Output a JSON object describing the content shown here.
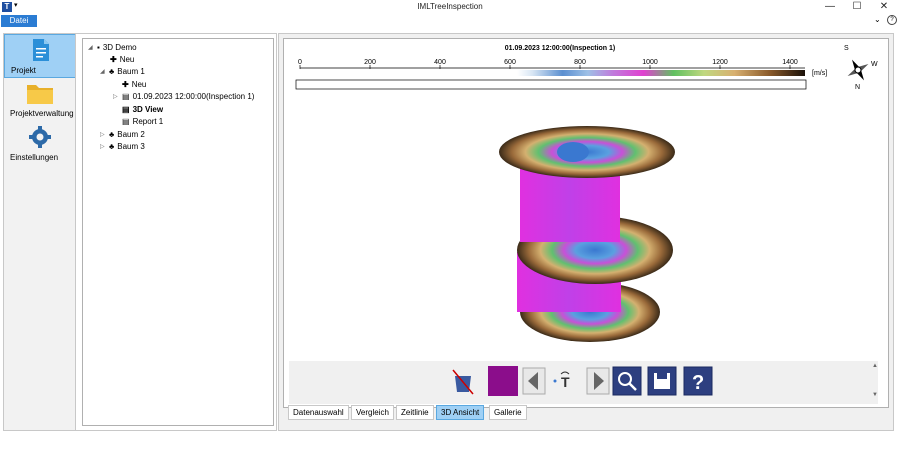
{
  "window": {
    "title": "IMLTreeInspection",
    "app_icon": "T",
    "minimize": "—",
    "maximize": "☐",
    "close": "✕"
  },
  "menu": {
    "datei": "Datei"
  },
  "nav": [
    {
      "label": "Projekt",
      "icon": "document-icon",
      "selected": true
    },
    {
      "label": "Projektverwaltung",
      "icon": "folder-icon"
    },
    {
      "label": "Einstellungen",
      "icon": "gear-icon"
    }
  ],
  "tree": {
    "root": "3D Demo",
    "neu1": "Neu",
    "baum1": "Baum 1",
    "neu2": "Neu",
    "inspection": "01.09.2023 12:00:00(Inspection 1)",
    "view3d": "3D View",
    "report": "Report 1",
    "baum2": "Baum 2",
    "baum3": "Baum 3"
  },
  "colorbar": {
    "title": "01.09.2023 12:00:00(Inspection 1)",
    "ticks": [
      "0",
      "200",
      "400",
      "600",
      "800",
      "1000",
      "1200",
      "1400"
    ],
    "unit": "[m/s]"
  },
  "compass": {
    "s": "S",
    "w": "W",
    "n": "N"
  },
  "tabs": [
    "Datenauswahl",
    "Vergleich",
    "Zeitlinie",
    "3D Ansicht",
    "Gallerie"
  ],
  "active_tab": "3D Ansicht",
  "colors": {
    "accent": "#2b7cd3",
    "selected": "#9fd0f5",
    "swatch": "#8b0d8b"
  }
}
